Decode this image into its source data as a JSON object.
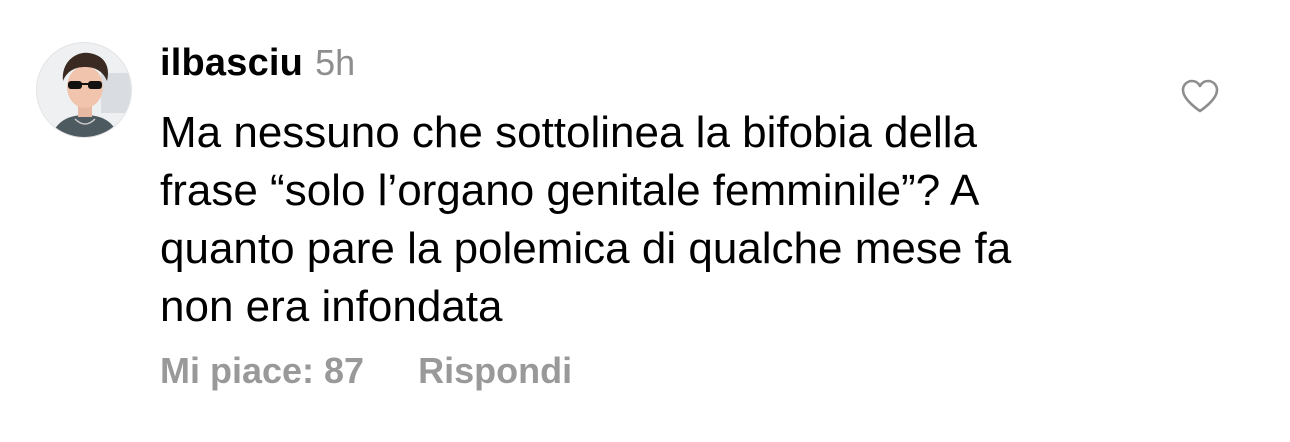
{
  "comment": {
    "avatar_icon": "user-avatar-photo",
    "username": "ilbasciu",
    "timestamp": "5h",
    "text": "Ma nessuno che sottolinea la bifobia della\nfrase “solo l’organo genitale femminile”? A\nquanto pare la polemica di qualche mese fa\nnon era infondata",
    "likes_label": "Mi piace: 87",
    "reply_label": "Rispondi",
    "like_icon": "heart-outline-icon"
  },
  "colors": {
    "text": "#000000",
    "muted": "#8e8e8e",
    "action": "#999999",
    "background": "#ffffff"
  }
}
